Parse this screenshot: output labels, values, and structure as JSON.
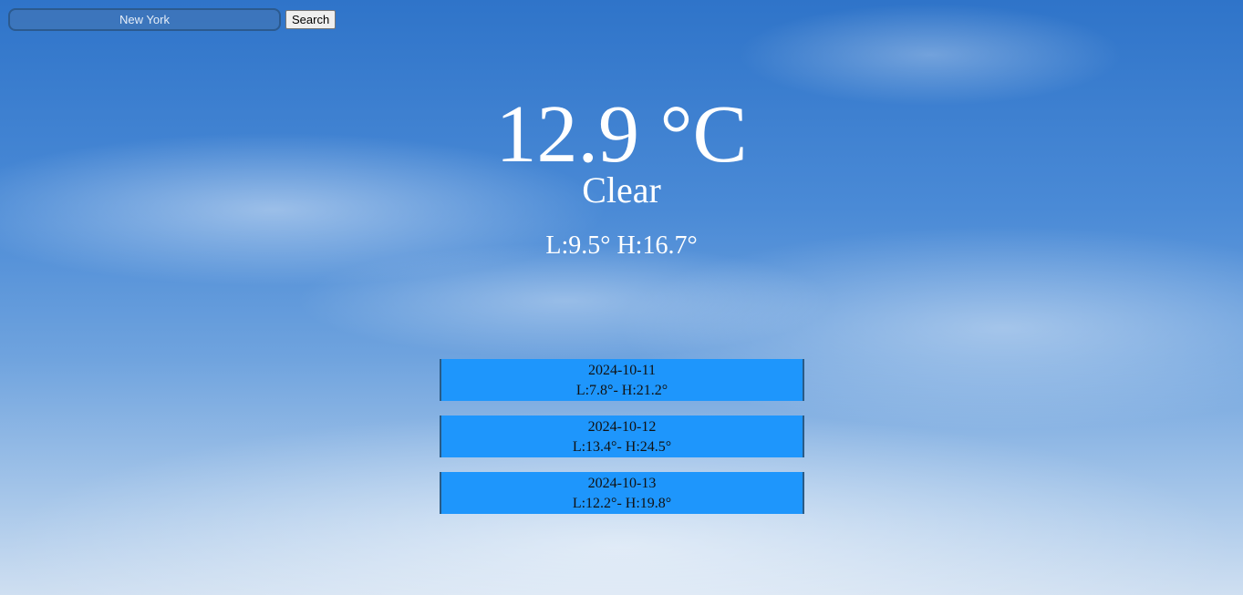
{
  "search": {
    "value": "New York",
    "button_label": "Search"
  },
  "current": {
    "temperature": "12.9 °C",
    "condition": "Clear",
    "range": "L:9.5° H:16.7°"
  },
  "forecast": [
    {
      "date": "2024-10-11",
      "range": "L:7.8°- H:21.2°"
    },
    {
      "date": "2024-10-12",
      "range": "L:13.4°- H:24.5°"
    },
    {
      "date": "2024-10-13",
      "range": "L:12.2°- H:19.8°"
    }
  ]
}
